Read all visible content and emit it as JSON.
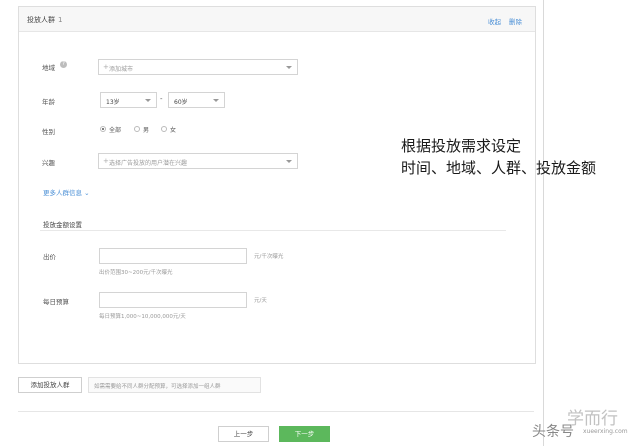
{
  "card": {
    "title": "投放人群",
    "count": "1",
    "collapse_label": "收起",
    "delete_label": "删除"
  },
  "region": {
    "label": "地域",
    "help_icon": "question-circle-icon",
    "placeholder": "添加城市"
  },
  "age": {
    "label": "年龄",
    "from": "13岁",
    "separator": "-",
    "to": "60岁"
  },
  "gender": {
    "label": "性别",
    "options": [
      "全部",
      "男",
      "女"
    ],
    "selected": "全部"
  },
  "interest": {
    "label": "兴趣",
    "placeholder": "选择广告投放的用户潜在兴趣"
  },
  "more_info": {
    "label": "更多人群信息"
  },
  "budget_section": {
    "title": "投放金额设置",
    "bid": {
      "label": "出价",
      "unit": "元/千次曝光",
      "hint": "出价范围30~200元/千次曝光"
    },
    "daily": {
      "label": "每日预算",
      "unit": "元/天",
      "hint": "每日预算1,000~10,000,000元/天"
    }
  },
  "add_audience": {
    "button_label": "添加投放人群",
    "hint": "如需需要给不同人群分配预算，可选择添加一组人群"
  },
  "nav": {
    "prev_label": "上一步",
    "next_label": "下一步"
  },
  "annotation": {
    "line1": "根据投放需求设定",
    "line2": "时间、地域、人群、投放金额"
  },
  "watermark": {
    "text1": "头条号",
    "text2": "学而行",
    "text3": "xueerxing.com"
  },
  "colors": {
    "accent_green": "#5cb85c",
    "link_blue": "#4a8fd6"
  }
}
